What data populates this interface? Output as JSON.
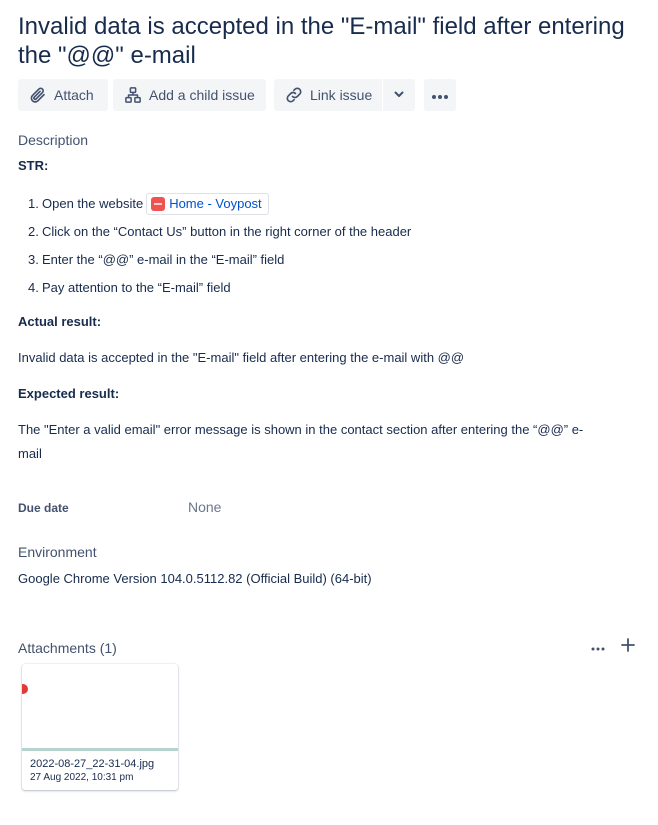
{
  "issue": {
    "title": "Invalid data is accepted in the \"E-mail\" field after entering the \"@@\" e-mail"
  },
  "toolbar": {
    "attach_label": "Attach",
    "child_label": "Add a child issue",
    "link_label": "Link issue",
    "icons": {
      "attach": "paperclip-icon",
      "child": "hierarchy-icon",
      "link": "link-icon",
      "dropdown": "chevron-down-icon",
      "more": "more-icon"
    }
  },
  "description": {
    "label": "Description",
    "str_heading": "STR:",
    "steps": [
      {
        "num": "1.",
        "text": "Open the website"
      },
      {
        "num": "2.",
        "text": "Click on the “Contact Us” button in the right corner of the header"
      },
      {
        "num": "3.",
        "text": "Enter the “@@” e-mail in the “E-mail” field"
      },
      {
        "num": "4.",
        "text": "Pay attention to the “E-mail” field"
      }
    ],
    "smartlink": {
      "text": "Home - Voypost",
      "icon": "voypost-favicon"
    },
    "actual_heading": "Actual result:",
    "actual_text": "Invalid data is accepted in the \"E-mail\" field after entering the e-mail with @@",
    "expected_heading": "Expected result:",
    "expected_text_line1": "The \"Enter a valid email\" error message is shown in the contact section after entering the “@@” e-",
    "expected_text_line2": "mail"
  },
  "fields": {
    "due_date_label": "Due date",
    "due_date_value": "None"
  },
  "environment": {
    "label": "Environment",
    "value": "Google Chrome Version 104.0.5112.82 (Official Build) (64-bit)"
  },
  "attachments": {
    "label": "Attachments (1)",
    "items": [
      {
        "name": "2022-08-27_22-31-04.jpg",
        "date": "27 Aug 2022, 10:31 pm"
      }
    ]
  },
  "colors": {
    "text": "#172b4d",
    "subtle": "#42526e",
    "link": "#0052cc",
    "button_bg": "#f4f5f7"
  }
}
